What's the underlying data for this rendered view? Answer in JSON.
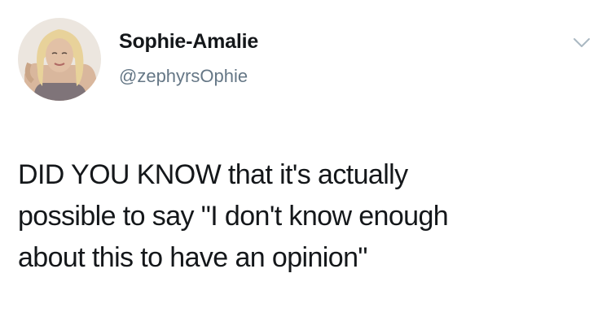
{
  "user": {
    "display_name": "Sophie-Amalie",
    "handle": "@zephyrsOphie",
    "avatar_icon": "profile-photo"
  },
  "menu_icon": "chevron-down-icon",
  "tweet": {
    "lines": [
      "DID YOU KNOW that it's actually",
      "possible to say \"I don't know enough",
      "about this to have an opinion\""
    ]
  },
  "colors": {
    "text": "#14171a",
    "secondary_text": "#657786",
    "chevron": "#aab8c2",
    "background": "#ffffff"
  }
}
